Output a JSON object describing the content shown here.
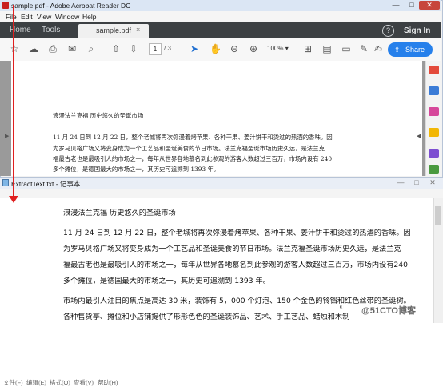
{
  "acrobat": {
    "title": "sample.pdf - Adobe Acrobat Reader DC",
    "menu": [
      "File",
      "Edit",
      "View",
      "Window",
      "Help"
    ],
    "tabs": {
      "home": "Home",
      "tools": "Tools",
      "doc": "sample.pdf",
      "close": "×"
    },
    "sign_in": "Sign In",
    "help": "?",
    "toolbar": {
      "page_current": "1",
      "page_total": "/ 3",
      "zoom": "100%",
      "share": "Share",
      "icons": [
        "star-icon",
        "upload-icon",
        "print-icon",
        "mail-icon",
        "zoom-search-icon",
        "upload-arrow-icon",
        "download-arrow-icon",
        "pointer-icon",
        "hand-icon",
        "zoom-out-icon",
        "zoom-in-icon",
        "fit-page-icon",
        "page-view-icon",
        "comment-icon",
        "pen-icon",
        "sign-icon"
      ]
    },
    "page_lines": [
      "浪漫法兰克福 历史悠久的圣诞市场",
      "11 月 24 日到 12 月 22 日，整个老城将再次弥漫着烤苹果、各种干果、姜汁饼干和烫过的热酒的香味。因",
      "为罗马贝格广场又将变身成为一个工艺品和圣诞美食的节日市场。法兰克福圣诞市场历史久远，是法兰克",
      "福最古老也是最吸引人的市场之一，每年从世界各地慕名到此参观的游客人数超过三百万，市场内设有 240",
      "多个摊位，是德国最大的市场之一，其历史可追溯到 1393 年。"
    ],
    "window_controls": {
      "minimize": "—",
      "maximize": "□",
      "close": "✕"
    }
  },
  "notepad": {
    "title": "ExtractText.txt - 记事本",
    "menu": [
      "文件(F)",
      "编辑(E)",
      "格式(O)",
      "查看(V)",
      "帮助(H)"
    ],
    "lines": [
      "浪漫法兰克福 历史悠久的圣诞市场",
      "11 月 24 日到 12 月 22 日，整个老城将再次弥漫着烤苹果、各种干果、姜汁饼干和烫过的热酒的香味。因",
      "为罗马贝格广场又将变身成为一个工艺品和圣诞美食的节日市场。法兰克福圣诞市场历史久远，是法兰克",
      "福最古老也是最吸引人的市场之一，每年从世界各地慕名到此参观的游客人数超过三百万，市场内设有240",
      "多个摊位，是德国最大的市场之一，其历史可追溯到 1393 年。",
      "市场内最引人注目的焦点是高达 30 米，装饰有 5，000 个灯泡、150 个金色的铃铛和红色丝带的圣诞树。",
      "各种售货亭、摊位和小店铺提供了形形色色的圣诞装饰品、艺术、手工艺品、蜡烛和木制"
    ],
    "window_controls": {
      "minimize": "—",
      "maximize": "□",
      "close": "✕"
    }
  },
  "watermark": "@51CTO博客",
  "colors": {
    "accent": "#2680eb",
    "annotation": "#e02020",
    "dark_bar": "#3c4043"
  }
}
